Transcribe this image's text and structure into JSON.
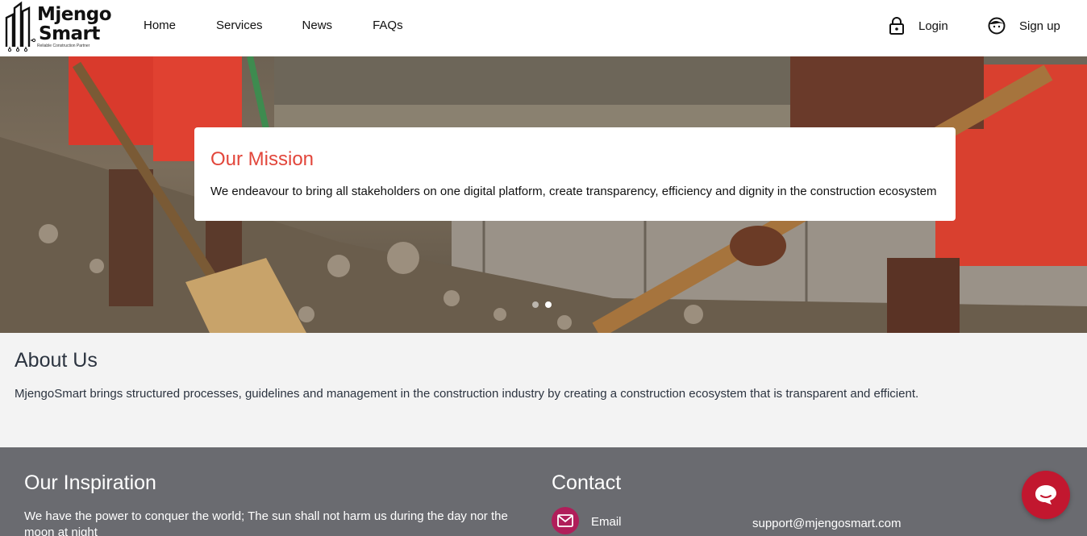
{
  "brand": {
    "name_line1": "Mjengo",
    "name_line2": "Smart",
    "tagline": "Reliable Construction Partner"
  },
  "nav": {
    "items": [
      {
        "label": "Home"
      },
      {
        "label": "Services"
      },
      {
        "label": "News"
      },
      {
        "label": "FAQs"
      }
    ]
  },
  "auth": {
    "login_label": "Login",
    "signup_label": "Sign up"
  },
  "hero": {
    "title": "Our Mission",
    "text": "We endeavour to bring all stakeholders on one digital platform, create transparency, efficiency and dignity in the construction ecosystem",
    "slide_count": 2,
    "active_slide": 2
  },
  "about": {
    "title": "About Us",
    "text": "MjengoSmart brings structured processes, guidelines and management in the construction industry by creating a construction ecosystem that is transparent and efficient."
  },
  "footer": {
    "inspiration_title": "Our Inspiration",
    "inspiration_text": "We have the power to conquer the world; The sun shall not harm us during the day nor the moon at night",
    "contact_title": "Contact",
    "email_label": "Email",
    "email_value": "support@mjengosmart.com"
  },
  "colors": {
    "accent_red": "#e2463b",
    "footer_bg": "#6a6b70",
    "email_icon_bg": "#b01e5a",
    "chat_bg": "#c2172f",
    "about_bg": "#f3f3f3"
  },
  "icons": {
    "login": "lock-icon",
    "signup": "user-face-icon",
    "email": "envelope-icon",
    "chat": "chat-bubble-icon"
  }
}
